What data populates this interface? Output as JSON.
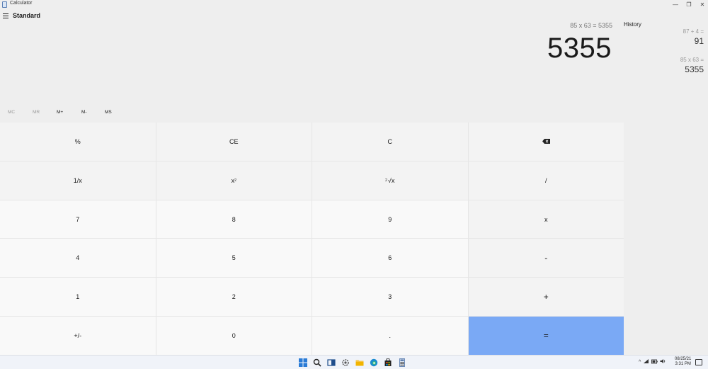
{
  "window": {
    "title": "Calculator",
    "minimize_glyph": "—",
    "maximize_glyph": "❐",
    "close_glyph": "✕"
  },
  "header": {
    "mode": "Standard"
  },
  "display": {
    "expression": "85 x 63 = 5355",
    "result": "5355"
  },
  "history": {
    "title": "History",
    "entries": [
      {
        "expression": "87 + 4 =",
        "result": "91"
      },
      {
        "expression": "85 x 63 =",
        "result": "5355"
      }
    ]
  },
  "memory": {
    "buttons": [
      {
        "label": "MC",
        "enabled": false
      },
      {
        "label": "MR",
        "enabled": false
      },
      {
        "label": "M+",
        "enabled": true
      },
      {
        "label": "M-",
        "enabled": true
      },
      {
        "label": "MS",
        "enabled": true
      }
    ]
  },
  "keypad": {
    "percent": "%",
    "ce": "CE",
    "c": "C",
    "reciprocal": "1/x",
    "square_base": "x",
    "square_exp": "2",
    "root_index": "2",
    "root_symbol": "√x",
    "divide": "/",
    "k7": "7",
    "k8": "8",
    "k9": "9",
    "multiply": "x",
    "k4": "4",
    "k5": "5",
    "k6": "6",
    "minus": "-",
    "k1": "1",
    "k2": "2",
    "k3": "3",
    "plus": "+",
    "negate": "+/-",
    "k0": "0",
    "decimal": ".",
    "equals": "="
  },
  "colors": {
    "equals_accent": "#7aa9f5",
    "background": "#eeeeee"
  },
  "taskbar": {
    "icons": [
      "windows-start-icon",
      "search-icon",
      "task-view-icon",
      "settings-icon",
      "file-explorer-icon",
      "edge-browser-icon",
      "store-icon",
      "calculator-icon"
    ],
    "tray_chevron": "^",
    "clock_date": "08/25/21",
    "clock_time": "3:31 PM"
  }
}
